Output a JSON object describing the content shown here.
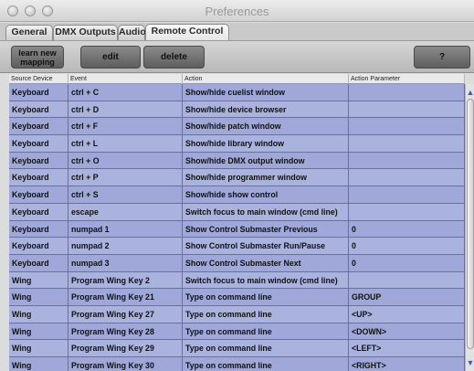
{
  "window": {
    "title": "Preferences"
  },
  "tabs": [
    {
      "label": "General"
    },
    {
      "label": "DMX Outputs"
    },
    {
      "label": "Audio"
    },
    {
      "label": "Remote Control"
    }
  ],
  "toolbar": {
    "learn_label": "learn new mapping",
    "edit_label": "edit",
    "delete_label": "delete",
    "help_label": "?"
  },
  "table": {
    "columns": [
      "Source Device",
      "Event",
      "Action",
      "Action Parameter"
    ],
    "rows": [
      [
        "Keyboard",
        "ctrl + C",
        "Show/hide cuelist window",
        ""
      ],
      [
        "Keyboard",
        "ctrl + D",
        "Show/hide device browser",
        ""
      ],
      [
        "Keyboard",
        "ctrl + F",
        "Show/hide patch window",
        ""
      ],
      [
        "Keyboard",
        "ctrl + L",
        "Show/hide library window",
        ""
      ],
      [
        "Keyboard",
        "ctrl + O",
        "Show/hide DMX output window",
        ""
      ],
      [
        "Keyboard",
        "ctrl + P",
        "Show/hide programmer window",
        ""
      ],
      [
        "Keyboard",
        "ctrl + S",
        "Show/hide show control",
        ""
      ],
      [
        "Keyboard",
        "escape",
        "Switch focus to main window (cmd line)",
        ""
      ],
      [
        "Keyboard",
        "numpad 1",
        "Show Control Submaster Previous",
        "0"
      ],
      [
        "Keyboard",
        "numpad 2",
        "Show Control Submaster Run/Pause",
        "0"
      ],
      [
        "Keyboard",
        "numpad 3",
        "Show Control Submaster Next",
        "0"
      ],
      [
        "Wing",
        "Program Wing Key 2",
        "Switch focus to main window (cmd line)",
        ""
      ],
      [
        "Wing",
        "Program Wing Key 21",
        "Type on command line",
        "GROUP"
      ],
      [
        "Wing",
        "Program Wing Key 27",
        "Type on command line",
        "<UP>"
      ],
      [
        "Wing",
        "Program Wing Key 28",
        "Type on command line",
        "<DOWN>"
      ],
      [
        "Wing",
        "Program Wing Key 29",
        "Type on command line",
        "<LEFT>"
      ],
      [
        "Wing",
        "Program Wing Key 30",
        "Type on command line",
        "<RIGHT>"
      ]
    ]
  }
}
